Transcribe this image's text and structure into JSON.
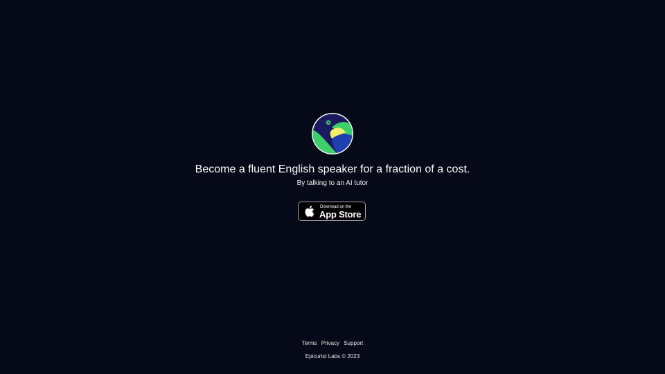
{
  "hero": {
    "logo_icon": "parrot-globe-logo-icon",
    "headline": "Become a fluent English speaker for a fraction of a cost.",
    "subheadline": "By talking to an AI tutor"
  },
  "app_store_badge": {
    "icon": "apple-icon",
    "small_text": "Download on the",
    "big_text": "App Store"
  },
  "footer": {
    "links": [
      {
        "label": "Terms"
      },
      {
        "label": "Privacy"
      },
      {
        "label": "Support"
      }
    ],
    "copyright": "Epicurist Labs © 2023"
  },
  "colors": {
    "background": "#060a18",
    "logo_ring": "#ffffff",
    "logo_dark": "#1a1b5e",
    "logo_green": "#3ecf6a",
    "logo_yellow": "#f2ec6b",
    "logo_blue": "#1f3fb0"
  }
}
